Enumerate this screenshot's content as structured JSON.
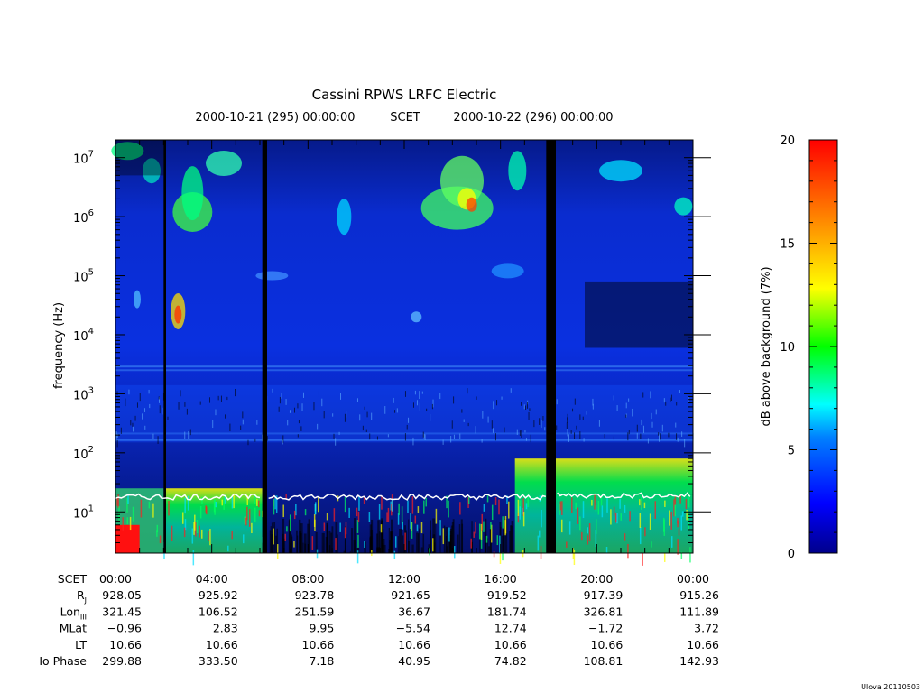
{
  "chart_data": {
    "type": "heatmap",
    "title": "Cassini RPWS LRFC Electric",
    "subtitle_start": "2000-10-21 (295) 00:00:00",
    "subtitle_scet": "SCET",
    "subtitle_end": "2000-10-22 (296) 00:00:00",
    "ylabel": "frequency (Hz)",
    "y_scale": "log",
    "ylim": [
      2,
      20000000
    ],
    "xlim": [
      0,
      24
    ],
    "y_ticks": [
      {
        "base": "10",
        "exp": "1",
        "value": 10
      },
      {
        "base": "10",
        "exp": "2",
        "value": 100
      },
      {
        "base": "10",
        "exp": "3",
        "value": 1000
      },
      {
        "base": "10",
        "exp": "4",
        "value": 10000
      },
      {
        "base": "10",
        "exp": "5",
        "value": 100000
      },
      {
        "base": "10",
        "exp": "6",
        "value": 1000000
      },
      {
        "base": "10",
        "exp": "7",
        "value": 10000000
      }
    ],
    "data_gaps_hours": [
      [
        2.0,
        2.1
      ],
      [
        6.1,
        6.3
      ],
      [
        17.9,
        18.3
      ]
    ],
    "colorbar": {
      "label": "dB above background (7%)",
      "range": [
        0,
        20
      ],
      "ticks": [
        "0",
        "5",
        "10",
        "15",
        "20"
      ],
      "colors": [
        "#00008b",
        "#0000ff",
        "#00ffff",
        "#00ff00",
        "#ffff00",
        "#ff8c00",
        "#ff0000"
      ]
    },
    "ephemeris": {
      "row_labels": [
        {
          "main": "SCET",
          "sub": ""
        },
        {
          "main": "R",
          "sub": "J"
        },
        {
          "main": "Lon",
          "sub": "III"
        },
        {
          "main": "MLat",
          "sub": ""
        },
        {
          "main": "LT",
          "sub": ""
        },
        {
          "main": "Io Phase",
          "sub": ""
        }
      ],
      "hours": [
        0,
        4,
        8,
        12,
        16,
        20,
        24
      ],
      "rows": [
        [
          "00:00",
          "04:00",
          "08:00",
          "12:00",
          "16:00",
          "20:00",
          "00:00"
        ],
        [
          "928.05",
          "925.92",
          "923.78",
          "921.65",
          "919.52",
          "917.39",
          "915.26"
        ],
        [
          "321.45",
          "106.52",
          "251.59",
          "36.67",
          "181.74",
          "326.81",
          "111.89"
        ],
        [
          "−0.96",
          "2.83",
          "9.95",
          "−5.54",
          "12.74",
          "−1.72",
          "3.72"
        ],
        [
          "10.66",
          "10.66",
          "10.66",
          "10.66",
          "10.66",
          "10.66",
          "10.66"
        ],
        [
          "299.88",
          "333.50",
          "7.18",
          "40.95",
          "74.82",
          "108.81",
          "142.93"
        ]
      ]
    }
  },
  "footer_stamp": "Ulova 20110503"
}
